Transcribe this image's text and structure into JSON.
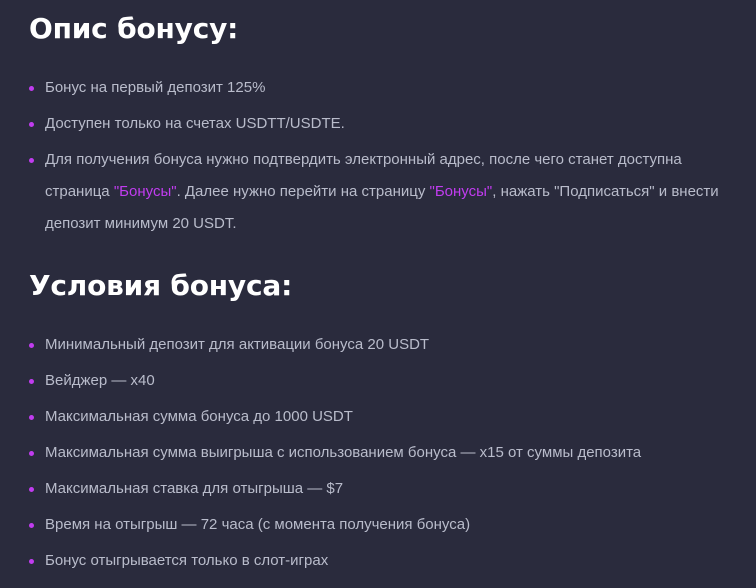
{
  "description": {
    "heading": "Опис бонусу:",
    "items": [
      "Бонус на первый депозит 125%",
      "Доступен только на счетах USDTT/USDTE.",
      {
        "before": "Для получения бонуса нужно подтвердить электронный адрес, после чего станет доступна страница ",
        "link1": "\"Бонусы\"",
        "middle": ". Далее нужно перейти на страницу ",
        "link2": "\"Бонусы\"",
        "after": ", нажать \"Подписаться\" и внести депозит минимум 20 USDT."
      }
    ]
  },
  "conditions": {
    "heading": "Условия бонуса:",
    "items": [
      "Минимальный депозит для активации бонуса 20 USDT",
      "Вейджер — x40",
      "Максимальная сумма бонуса до 1000 USDT",
      "Максимальная сумма выигрыша с использованием бонуса — x15 от суммы депозита",
      "Максимальная ставка для отыгрыша — $7",
      "Время на отыгрыш — 72 часа (с момента получения бонуса)",
      "Бонус отыгрывается только в слот-играх"
    ]
  },
  "colors": {
    "background": "#2a2b3d",
    "heading": "#ffffff",
    "text": "#b9bccb",
    "accent": "#c13cf0"
  }
}
